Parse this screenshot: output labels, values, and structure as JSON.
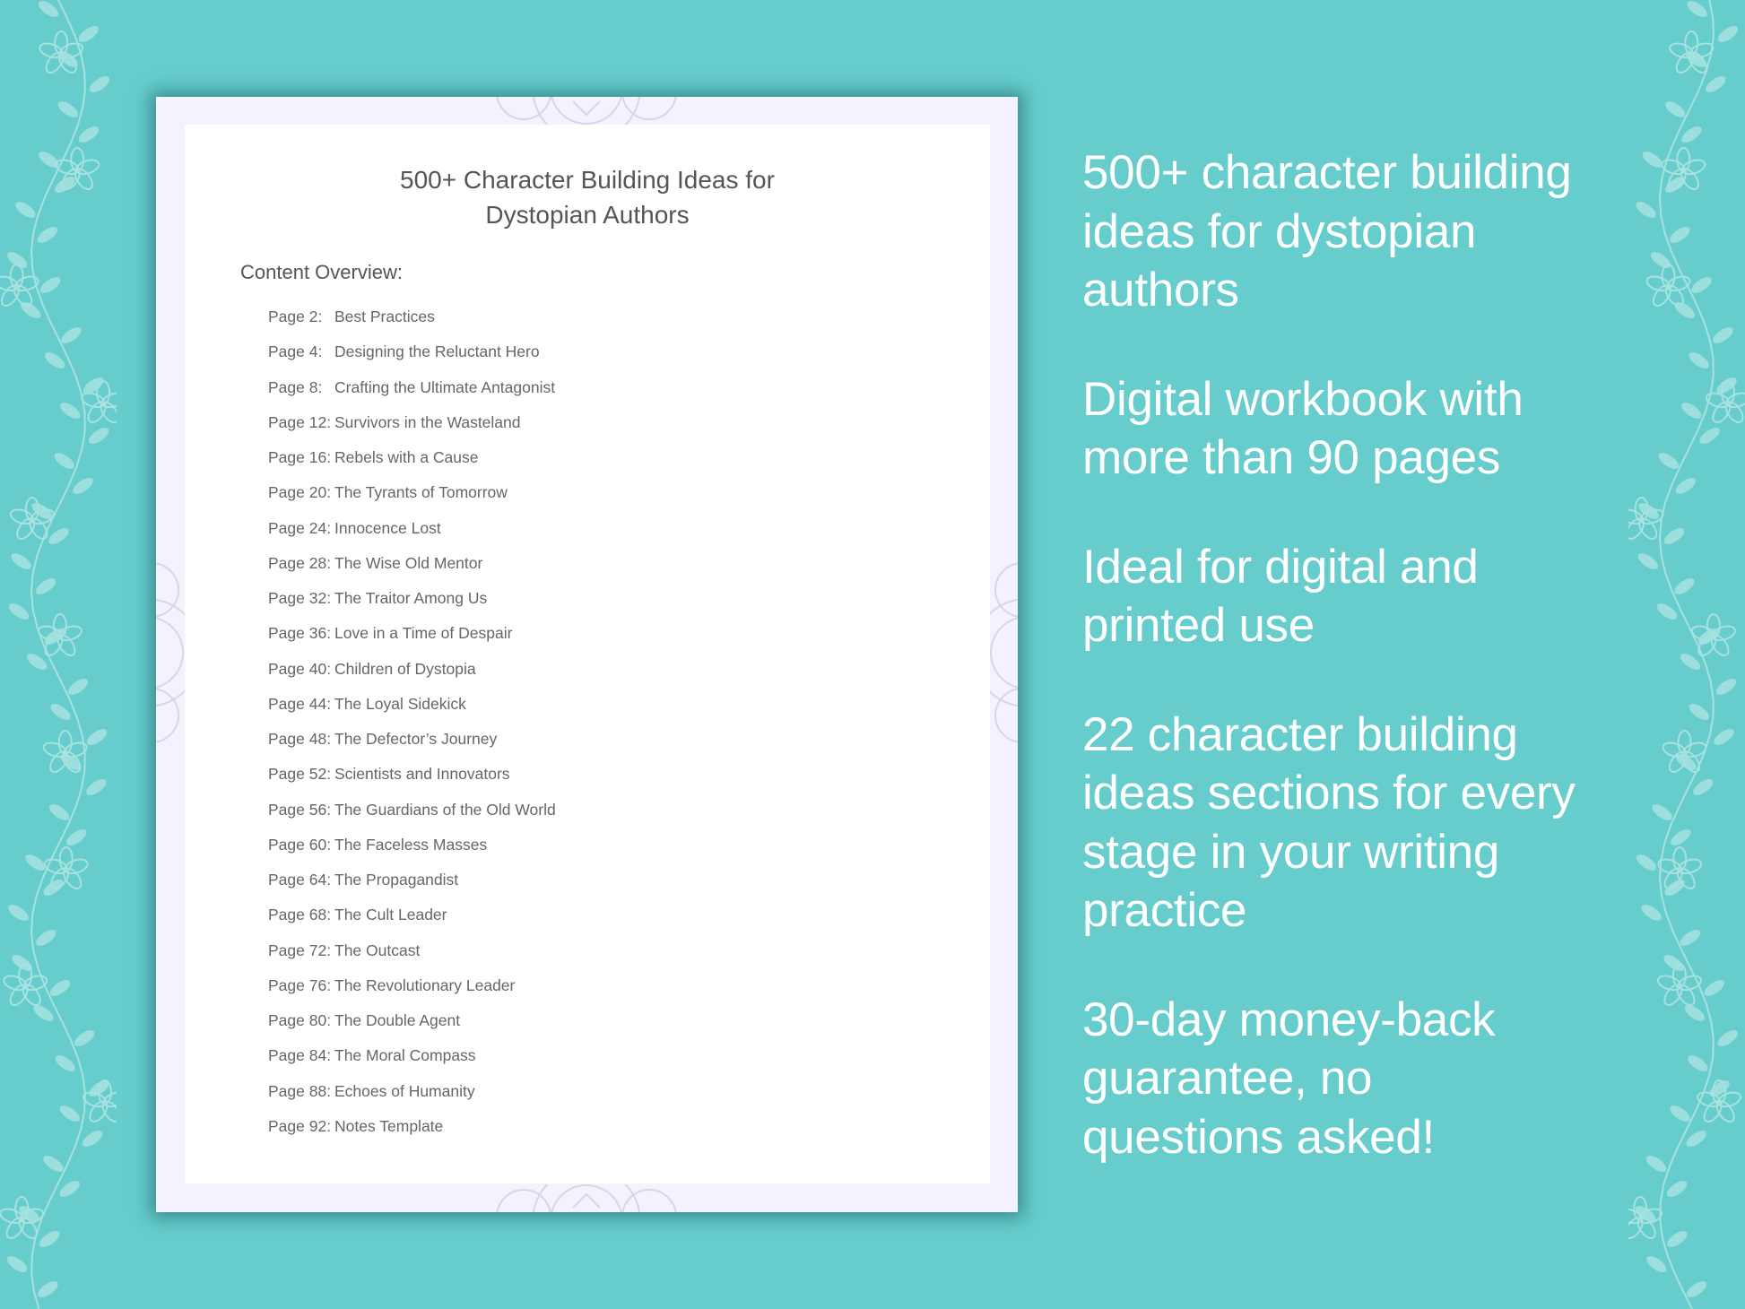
{
  "colors": {
    "background": "#66cccc",
    "page_border": "#f4f2fc",
    "page": "#ffffff",
    "text_dark": "#555555",
    "text_light": "#ffffff",
    "vine": "#a6e2df"
  },
  "document": {
    "title_line1": "500+ Character Building Ideas for",
    "title_line2": "Dystopian Authors",
    "overview_label": "Content Overview:",
    "toc": [
      {
        "page": "Page  2:",
        "title": "Best Practices"
      },
      {
        "page": "Page  4:",
        "title": "Designing the Reluctant Hero"
      },
      {
        "page": "Page  8:",
        "title": "Crafting the Ultimate Antagonist"
      },
      {
        "page": "Page 12:",
        "title": "Survivors in the Wasteland"
      },
      {
        "page": "Page 16:",
        "title": "Rebels with a Cause"
      },
      {
        "page": "Page 20:",
        "title": "The Tyrants of Tomorrow"
      },
      {
        "page": "Page 24:",
        "title": "Innocence Lost"
      },
      {
        "page": "Page 28:",
        "title": "The Wise Old Mentor"
      },
      {
        "page": "Page 32:",
        "title": "The Traitor Among Us"
      },
      {
        "page": "Page 36:",
        "title": "Love in a Time of Despair"
      },
      {
        "page": "Page 40:",
        "title": "Children of Dystopia"
      },
      {
        "page": "Page 44:",
        "title": "The Loyal Sidekick"
      },
      {
        "page": "Page 48:",
        "title": "The Defector’s Journey"
      },
      {
        "page": "Page 52:",
        "title": "Scientists and Innovators"
      },
      {
        "page": "Page 56:",
        "title": "The Guardians of the Old World"
      },
      {
        "page": "Page 60:",
        "title": "The Faceless Masses"
      },
      {
        "page": "Page 64:",
        "title": "The Propagandist"
      },
      {
        "page": "Page 68:",
        "title": "The Cult Leader"
      },
      {
        "page": "Page 72:",
        "title": "The Outcast"
      },
      {
        "page": "Page 76:",
        "title": "The Revolutionary Leader"
      },
      {
        "page": "Page 80:",
        "title": "The Double Agent"
      },
      {
        "page": "Page 84:",
        "title": "The Moral Compass"
      },
      {
        "page": "Page 88:",
        "title": "Echoes of Humanity"
      },
      {
        "page": "Page 92:",
        "title": "Notes Template"
      }
    ]
  },
  "features": [
    [
      "500+ character building",
      "ideas for dystopian",
      "authors"
    ],
    [
      "Digital workbook with",
      "more than 90 pages"
    ],
    [
      "Ideal for digital and",
      "printed use"
    ],
    [
      "22 character building",
      "ideas sections for every",
      "stage in your writing",
      "practice"
    ],
    [
      "30-day money-back",
      "guarantee, no",
      "questions asked!"
    ]
  ],
  "icons": {
    "decoration": "floral-vine",
    "page_ornament": "mandala"
  }
}
